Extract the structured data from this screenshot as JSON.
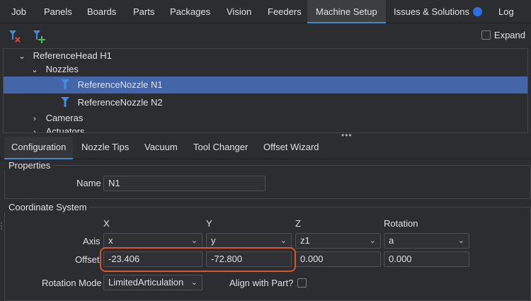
{
  "tabs": [
    "Job",
    "Panels",
    "Boards",
    "Parts",
    "Packages",
    "Vision",
    "Feeders",
    "Machine Setup",
    "Issues & Solutions",
    "Log"
  ],
  "active_tab": "Machine Setup",
  "toolbar": {
    "expand_label": "Expand",
    "add_icon": "add-nozzle-icon",
    "remove_icon": "remove-nozzle-icon"
  },
  "tree": {
    "items": [
      {
        "label": "ReferenceHead H1",
        "expanded": true
      },
      {
        "label": "Nozzles",
        "expanded": true
      },
      {
        "label": "ReferenceNozzle N1",
        "selected": true,
        "icon": "nozzle-icon"
      },
      {
        "label": "ReferenceNozzle N2",
        "icon": "nozzle-icon"
      },
      {
        "label": "Cameras",
        "expanded": false
      },
      {
        "label": "Actuators",
        "expanded": false
      }
    ]
  },
  "subtabs": [
    "Configuration",
    "Nozzle Tips",
    "Vacuum",
    "Tool Changer",
    "Offset Wizard"
  ],
  "active_subtab": "Configuration",
  "properties": {
    "title": "Properties",
    "name_label": "Name",
    "name_value": "N1"
  },
  "coordinate_system": {
    "title": "Coordinate System",
    "columns": [
      "X",
      "Y",
      "Z",
      "Rotation"
    ],
    "axis_label": "Axis",
    "axis_values": [
      "x",
      "y",
      "z1",
      "a"
    ],
    "offset_label": "Offset",
    "offset_values": [
      "-23.406",
      "-72.800",
      "0.000",
      "0.000"
    ],
    "rotation_mode_label": "Rotation Mode",
    "rotation_mode_value": "LimitedArticulation",
    "align_label": "Align with Part?"
  },
  "colors": {
    "accent": "#4a86c7",
    "selection": "#4465a8",
    "highlight": "#d9552c",
    "badge": "#2f6de1"
  }
}
